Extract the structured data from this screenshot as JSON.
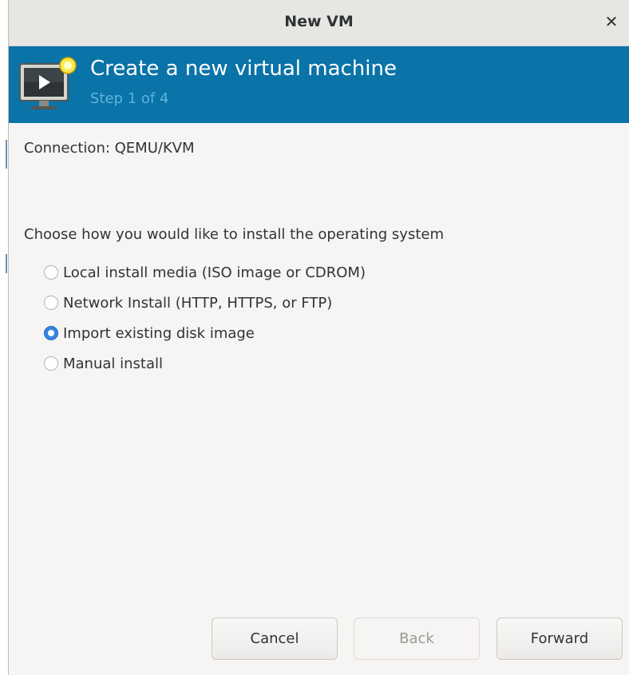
{
  "window": {
    "title": "New VM",
    "close_icon": "close-icon"
  },
  "banner": {
    "heading": "Create a new virtual machine",
    "step": "Step 1 of 4",
    "icon": "vm-monitor-icon",
    "background": "#0a73a8"
  },
  "connection": {
    "text": "Connection: QEMU/KVM"
  },
  "install": {
    "prompt": "Choose how you would like to install the operating system",
    "options": [
      {
        "label": "Local install media (ISO image or CDROM)",
        "selected": false
      },
      {
        "label": "Network Install (HTTP, HTTPS, or FTP)",
        "selected": false
      },
      {
        "label": "Import existing disk image",
        "selected": true
      },
      {
        "label": "Manual install",
        "selected": false
      }
    ]
  },
  "buttons": {
    "cancel": "Cancel",
    "back": "Back",
    "forward": "Forward"
  },
  "colors": {
    "accent": "#3584e4",
    "step_text": "#5cb4dc"
  }
}
